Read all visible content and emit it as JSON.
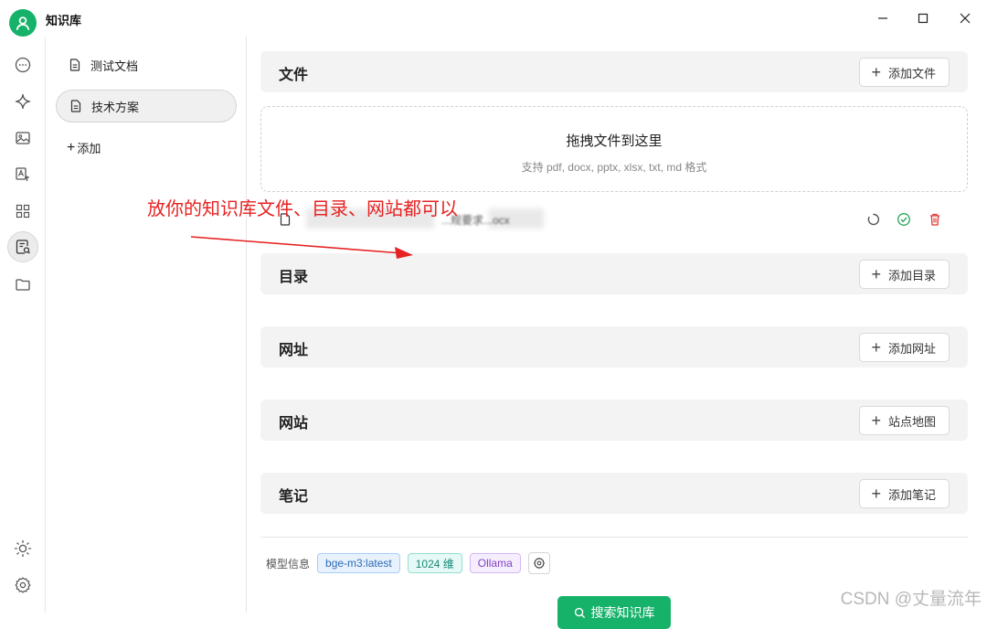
{
  "window": {
    "title": "知识库",
    "controls": [
      "minimize",
      "maximize",
      "close"
    ]
  },
  "rail": {
    "icons": [
      "chat-icon",
      "sparkle-icon",
      "image-icon",
      "translate-icon",
      "apps-icon",
      "knowledge-icon",
      "folder-icon",
      "theme-sun-icon",
      "settings-icon"
    ],
    "active": "knowledge-icon"
  },
  "knowledge_bases": {
    "items": [
      {
        "label": "测试文档",
        "selected": false
      },
      {
        "label": "技术方案",
        "selected": true
      }
    ],
    "add_label": "添加"
  },
  "sections": {
    "files": {
      "title": "文件",
      "button": "添加文件"
    },
    "dropzone": {
      "main": "拖拽文件到这里",
      "sub": "支持 pdf, docx, pptx, xlsx, txt, md 格式"
    },
    "file_row": {
      "name": "...规要求...ocx",
      "status_actions": [
        "refresh-icon",
        "check-circle-icon",
        "delete-icon"
      ]
    },
    "directories": {
      "title": "目录",
      "button": "添加目录"
    },
    "urls": {
      "title": "网址",
      "button": "添加网址"
    },
    "websites": {
      "title": "网站",
      "button": "站点地图"
    },
    "notes": {
      "title": "笔记",
      "button": "添加笔记"
    }
  },
  "model_info": {
    "label": "模型信息",
    "model": "bge-m3:latest",
    "dimensions": "1024 维",
    "provider": "Ollama"
  },
  "search_button": "搜索知识库",
  "annotation": "放你的知识库文件、目录、网站都可以",
  "watermark": "CSDN @丈量流年",
  "colors": {
    "accent": "#17b26a",
    "annotation": "#e62222"
  }
}
